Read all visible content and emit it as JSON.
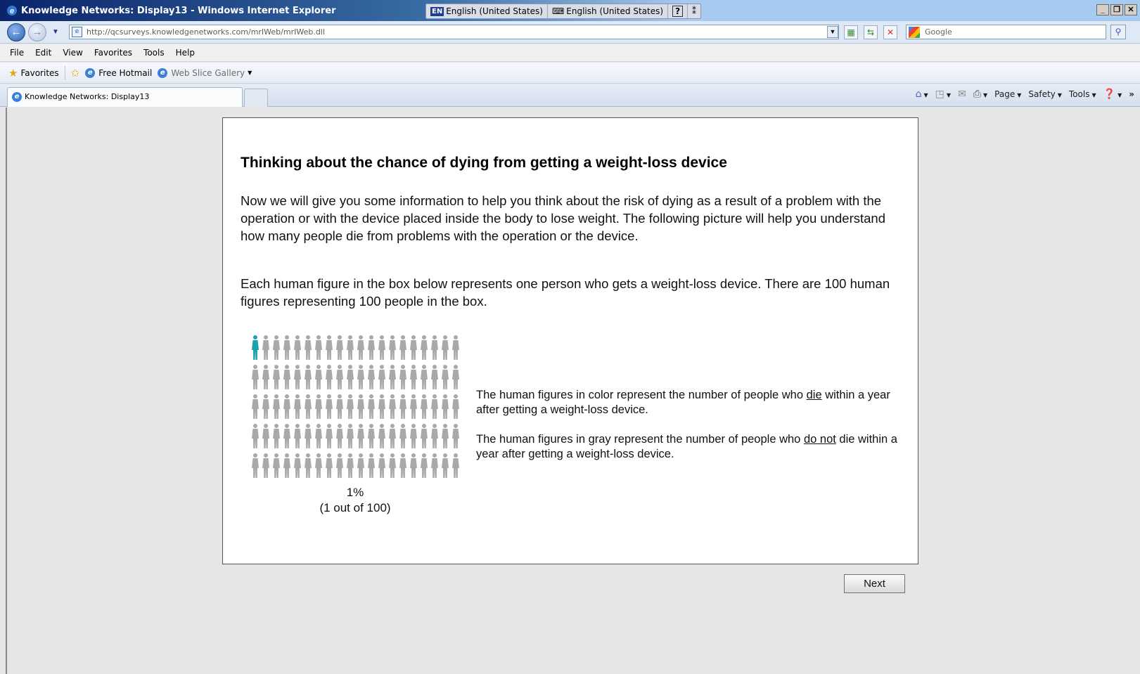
{
  "window": {
    "title": "Knowledge Networks: Display13 - Windows Internet Explorer",
    "language_badge": "EN",
    "input_language": "English (United States)",
    "keyboard_language": "English (United States)",
    "help_icon": "?"
  },
  "address": {
    "url": "http://qcsurveys.knowledgenetworks.com/mrIWeb/mrIWeb.dll",
    "search_placeholder": "Google"
  },
  "menu": [
    "File",
    "Edit",
    "View",
    "Favorites",
    "Tools",
    "Help"
  ],
  "favorites": {
    "favorites_label": "Favorites",
    "hotmail_label": "Free Hotmail",
    "slice_label": "Web Slice Gallery"
  },
  "tab": {
    "label": "Knowledge Networks: Display13"
  },
  "commands": {
    "page": "Page",
    "safety": "Safety",
    "tools": "Tools"
  },
  "survey": {
    "heading": "Thinking about the chance of dying from getting a weight-loss device",
    "paragraph1": "Now we will give you some information to help you think about the risk of dying as a result of a problem with the operation or with the device placed inside the body to lose weight. The following picture will help you understand how many people die from problems with the operation or the device.",
    "paragraph2": "Each human figure in the box below represents one person who gets a weight-loss device. There are 100 human figures representing 100 people in the box.",
    "icon_array": {
      "total": 100,
      "colored": 1,
      "colored_color": "#1aa3ad",
      "gray_color": "#a9a9a9"
    },
    "percent": "1%",
    "fraction": "(1 out of 100)",
    "legend_color_before": "The human figures in color represent the number of people who ",
    "legend_color_emph": "die",
    "legend_color_after": " within a year after getting a weight-loss device.",
    "legend_gray_before": "The human figures in gray represent the number of people who ",
    "legend_gray_emph": "do not",
    "legend_gray_after": " die within a year after getting a weight-loss device.",
    "next_label": "Next"
  }
}
